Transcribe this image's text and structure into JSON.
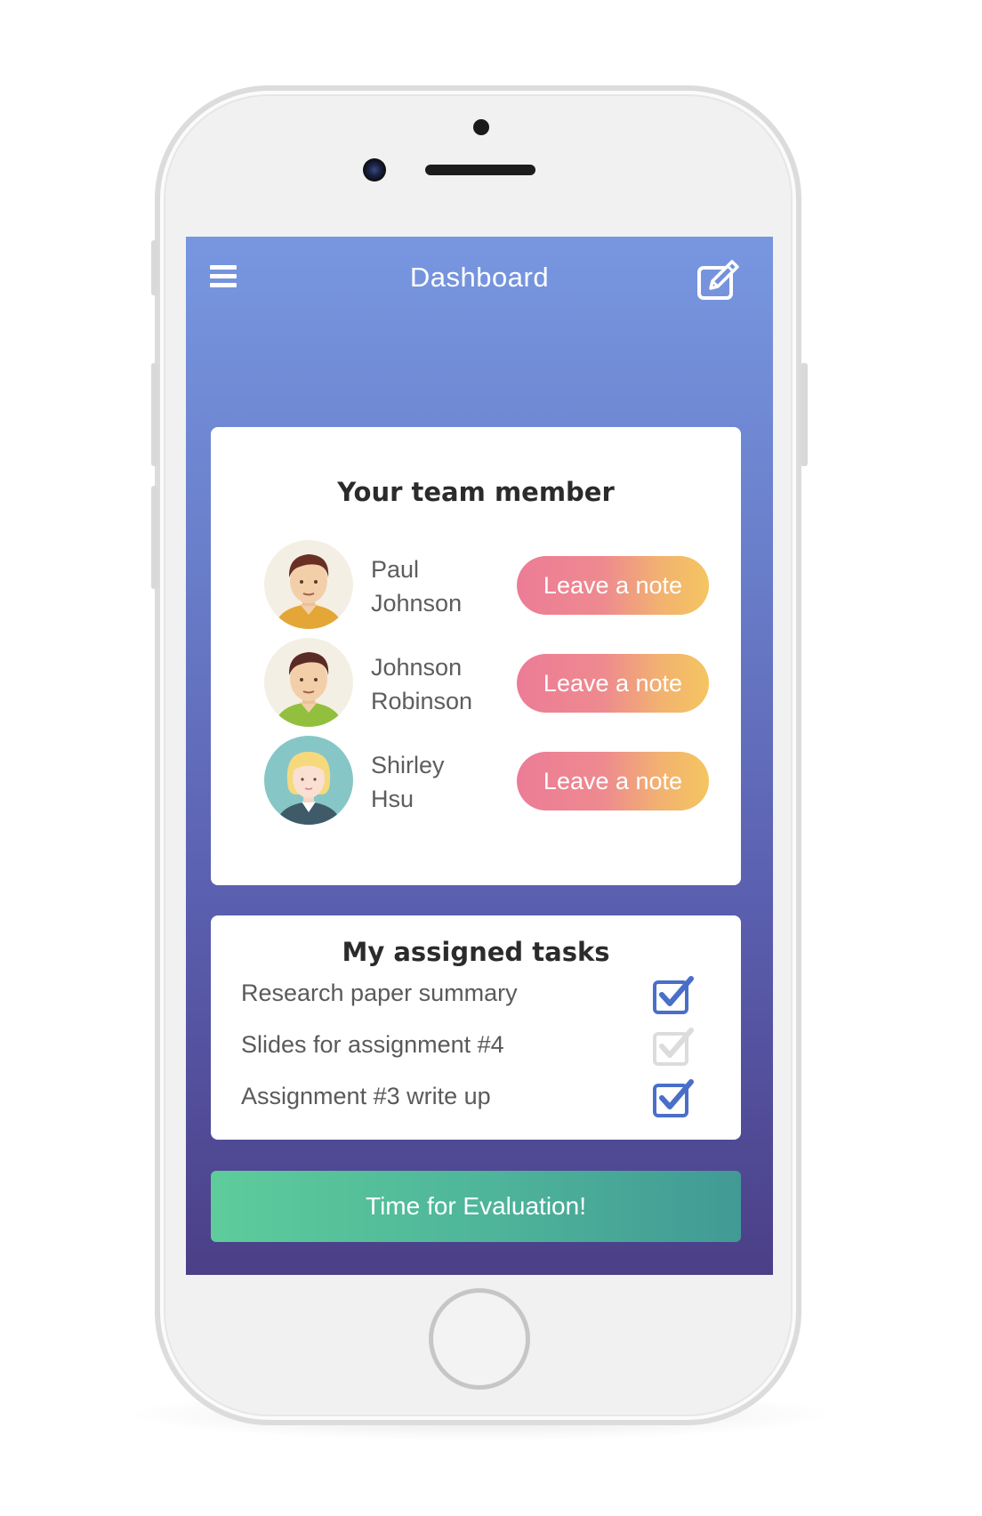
{
  "header": {
    "title": "Dashboard",
    "menu_icon": "hamburger-menu-icon",
    "edit_icon": "edit-note-icon"
  },
  "team": {
    "title": "Your team member",
    "members": [
      {
        "first": "Paul",
        "last": "Johnson",
        "avatar": "male-avatar-yellow-shirt",
        "button": "Leave a note"
      },
      {
        "first": "Johnson",
        "last": "Robinson",
        "avatar": "male-avatar-green-shirt",
        "button": "Leave a note"
      },
      {
        "first": "Shirley",
        "last": "Hsu",
        "avatar": "female-avatar-blonde",
        "button": "Leave a note"
      }
    ]
  },
  "tasks": {
    "title": "My assigned tasks",
    "items": [
      {
        "label": "Research paper summary",
        "checked": true
      },
      {
        "label": "Slides for assignment #4",
        "checked": false
      },
      {
        "label": "Assignment #3 write up",
        "checked": true
      }
    ]
  },
  "evaluation_button": "Time for Evaluation!",
  "colors": {
    "header_gradient_top": "#7897e0",
    "header_gradient_bottom": "#4b3f87",
    "note_button_start": "#ec7c96",
    "note_button_end": "#f5c560",
    "eval_button_start": "#5ecc9b",
    "eval_button_end": "#419a95",
    "checkbox_checked": "#4a6fc9",
    "checkbox_unchecked": "#dcdcdc"
  }
}
